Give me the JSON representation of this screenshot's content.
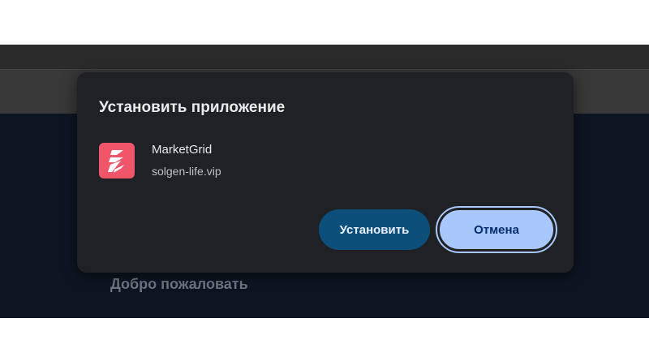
{
  "dialog": {
    "title": "Установить приложение",
    "app_name": "MarketGrid",
    "app_domain": "solgen-life.vip",
    "install_label": "Установить",
    "cancel_label": "Отмена"
  },
  "page": {
    "welcome_text": "Добро пожаловать"
  },
  "colors": {
    "dialog_bg": "#202124",
    "install_bg": "#0b4f7a",
    "cancel_bg": "#a8c7fa",
    "app_icon_bg": "#f0556a"
  }
}
